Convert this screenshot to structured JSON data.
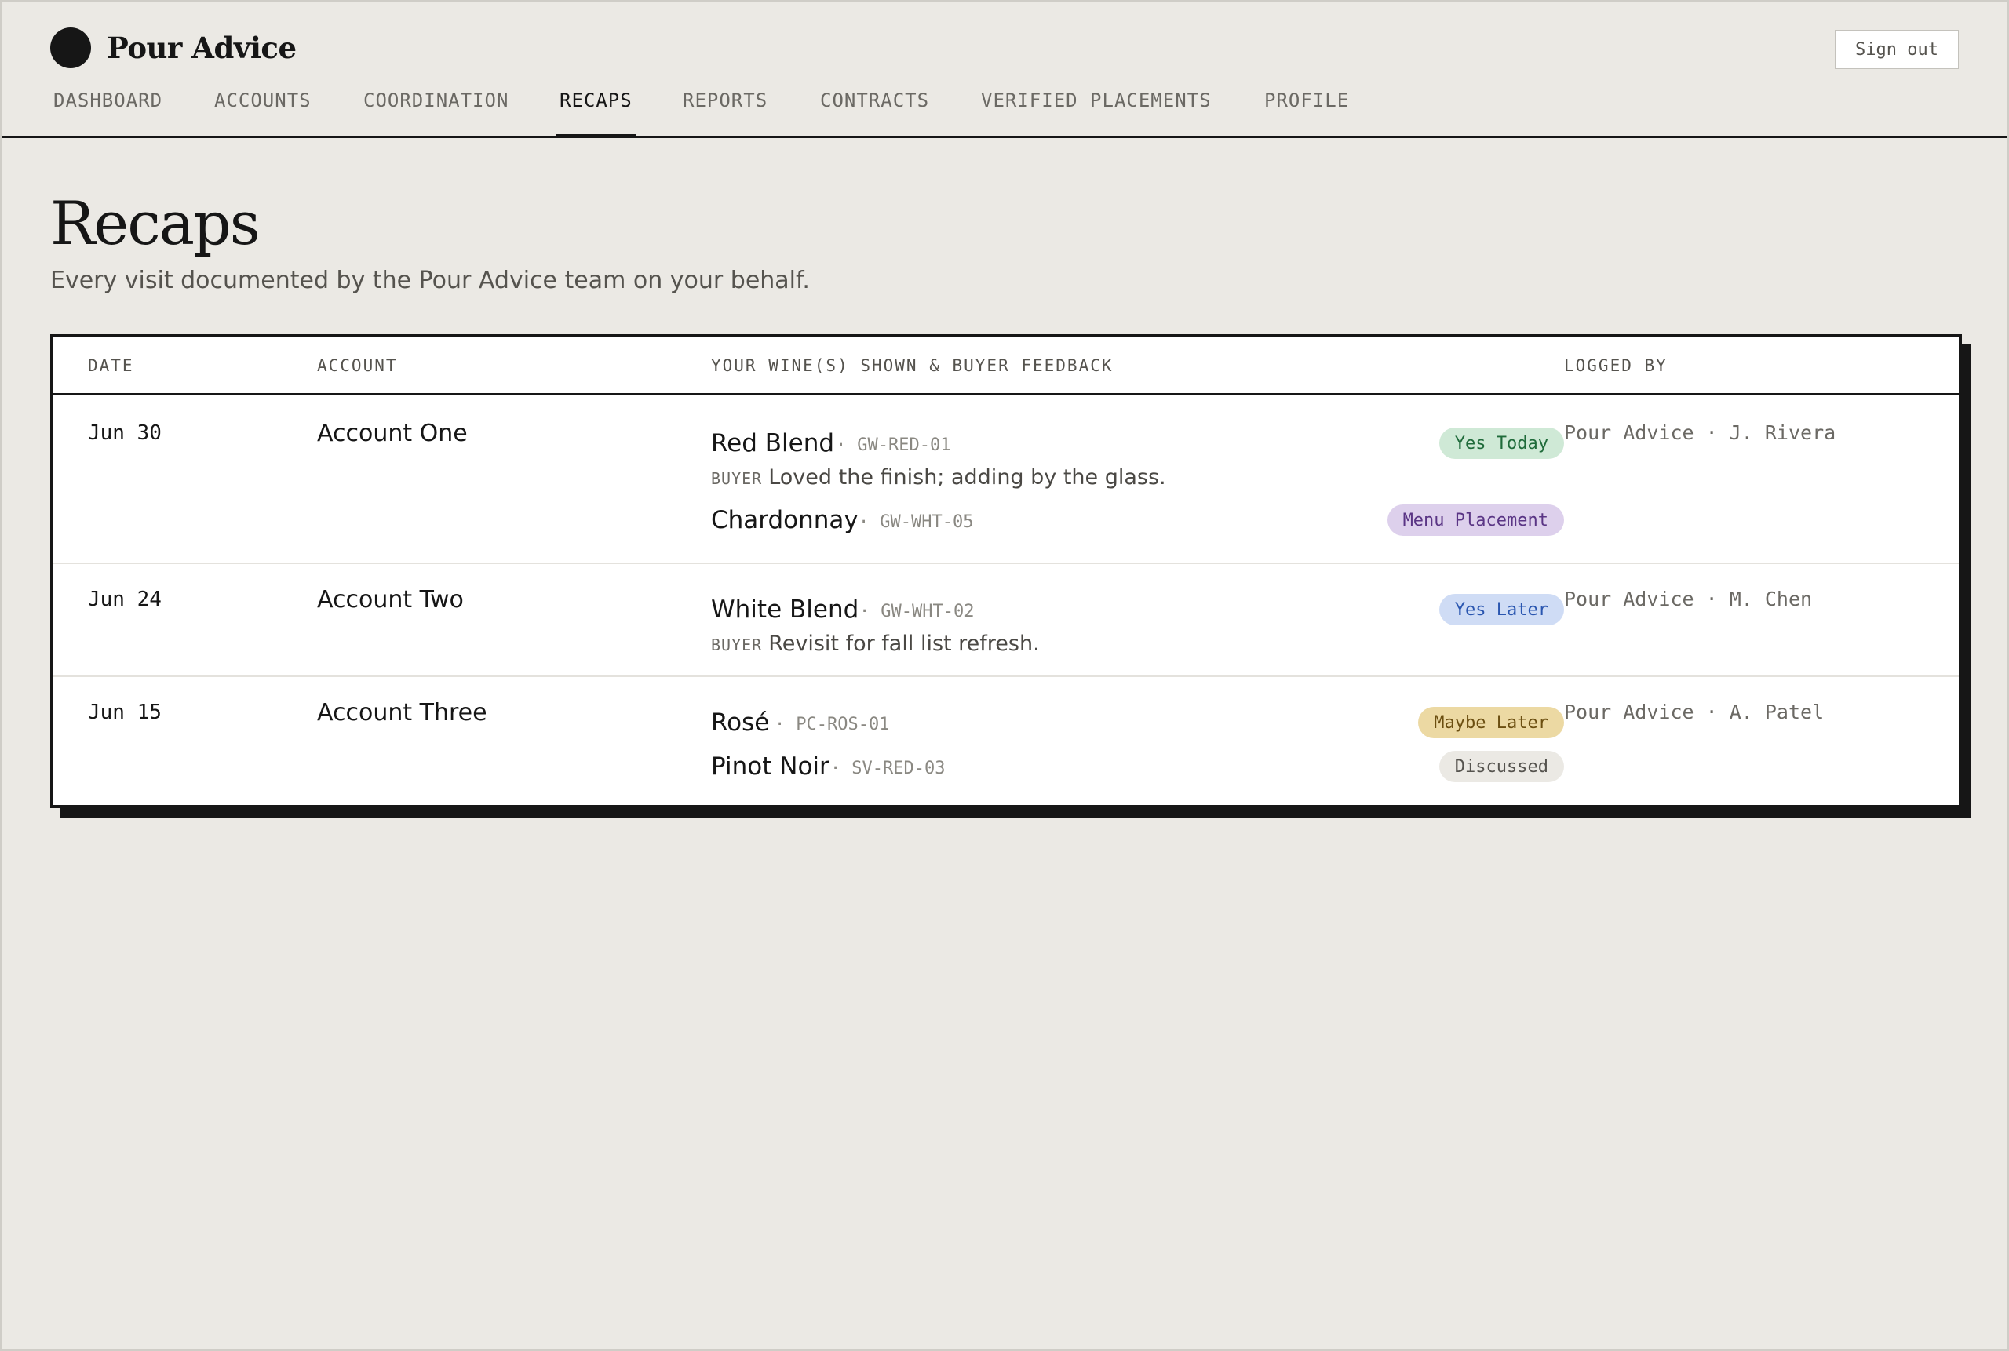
{
  "app": {
    "brand_name": "Pour Advice",
    "signout_label": "Sign out"
  },
  "nav": {
    "items": [
      {
        "label": "DASHBOARD"
      },
      {
        "label": "ACCOUNTS"
      },
      {
        "label": "COORDINATION"
      },
      {
        "label": "RECAPS",
        "active": true
      },
      {
        "label": "REPORTS"
      },
      {
        "label": "CONTRACTS"
      },
      {
        "label": "VERIFIED PLACEMENTS"
      },
      {
        "label": "PROFILE"
      }
    ]
  },
  "page": {
    "title": "Recaps",
    "subtitle": "Every visit documented by the Pour Advice team on your behalf."
  },
  "table": {
    "columns": {
      "date": "DATE",
      "account": "ACCOUNT",
      "wines": "YOUR WINE(S) SHOWN & BUYER FEEDBACK",
      "logged_by": "LOGGED BY"
    },
    "buyer_tag": "BUYER",
    "separator": "·",
    "rows": [
      {
        "date": "Jun 30",
        "account": "Account One",
        "logged_by": "Pour Advice · J. Rivera",
        "wines": [
          {
            "name": "Red Blend",
            "sku": "GW-RED-01",
            "status": "Yes Today",
            "status_kind": "green",
            "feedback": "Loved the finish; adding by the glass."
          },
          {
            "name": "Chardonnay",
            "sku": "GW-WHT-05",
            "status": "Menu Placement",
            "status_kind": "purple"
          }
        ]
      },
      {
        "date": "Jun 24",
        "account": "Account Two",
        "logged_by": "Pour Advice · M. Chen",
        "wines": [
          {
            "name": "White Blend",
            "sku": "GW-WHT-02",
            "status": "Yes Later",
            "status_kind": "blue",
            "feedback": "Revisit for fall list refresh."
          }
        ]
      },
      {
        "date": "Jun 15",
        "account": "Account Three",
        "logged_by": "Pour Advice · A. Patel",
        "wines": [
          {
            "name": "Rosé",
            "sku": "PC-ROS-01",
            "status": "Maybe Later",
            "status_kind": "amber"
          },
          {
            "name": "Pinot Noir",
            "sku": "SV-RED-03",
            "status": "Discussed",
            "status_kind": "gray"
          }
        ]
      }
    ]
  },
  "status_colors": {
    "green": {
      "bg": "#cfe9d6",
      "fg": "#1f6b3a"
    },
    "purple": {
      "bg": "#ddd0ec",
      "fg": "#5a3585"
    },
    "blue": {
      "bg": "#cfdcf5",
      "fg": "#2a56b0"
    },
    "amber": {
      "bg": "#ecd9a3",
      "fg": "#6b4e10"
    },
    "gray": {
      "bg": "#ebe9e4",
      "fg": "#55534e"
    }
  }
}
